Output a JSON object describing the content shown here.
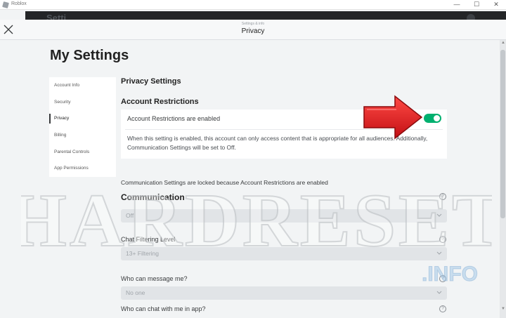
{
  "window": {
    "app_title": "Roblox",
    "controls": [
      "—",
      "☐",
      "✕"
    ],
    "icon": "roblox-app-icon"
  },
  "background": {
    "text": "Setti"
  },
  "header": {
    "breadcrumb": "Settings & info",
    "title": "Privacy",
    "close_icon": "close-icon"
  },
  "page": {
    "title": "My Settings"
  },
  "sidebar": {
    "items": [
      {
        "label": "Account Info",
        "active": false
      },
      {
        "label": "Security",
        "active": false
      },
      {
        "label": "Privacy",
        "active": true
      },
      {
        "label": "Billing",
        "active": false
      },
      {
        "label": "Parental Controls",
        "active": false
      },
      {
        "label": "App Permissions",
        "active": false
      }
    ]
  },
  "privacy": {
    "section_title": "Privacy Settings",
    "restrictions": {
      "title": "Account Restrictions",
      "toggle_label": "Account Restrictions are enabled",
      "toggle_on": true,
      "description": "When this setting is enabled, this account can only access content that is appropriate for all audiences. Additionally, Communication Settings will be set to Off."
    },
    "locked_note": "Communication Settings are locked because Account Restrictions are enabled",
    "communication": {
      "title": "Communication",
      "value": "Off",
      "help_icon": "question-circle-icon"
    },
    "chat_filter": {
      "label": "Chat Filtering Level",
      "value": "13+ Filtering"
    },
    "message_me": {
      "label": "Who can message me?",
      "value": "No one"
    },
    "chat_in_app": {
      "label": "Who can chat with me in app?"
    }
  },
  "watermark": {
    "main": "HARDRESET",
    "sub": ".INFO"
  },
  "colors": {
    "toggle_on": "#00b06f",
    "annotation_arrow": "#e0191e",
    "disabled_select": "#e1e4e7"
  }
}
